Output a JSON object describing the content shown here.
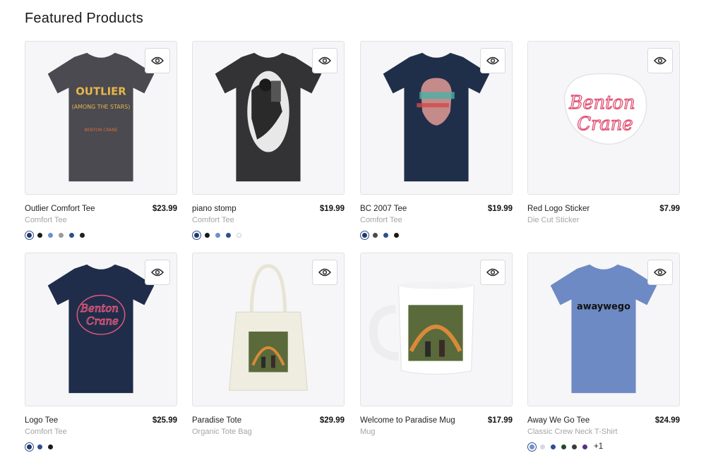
{
  "section": {
    "title": "Featured Products"
  },
  "products": [
    {
      "title": "Outlier Comfort Tee",
      "subtitle": "Comfort Tee",
      "price": "$23.99",
      "swatches": [
        "#1e3a6e",
        "#1a1a1a",
        "#6e8fcf",
        "#9a9a9a",
        "#2d4f8e",
        "#202020"
      ],
      "art": {
        "shirt_color": "#4a4a50",
        "lines": [
          "OUTLIER",
          "(AMONG THE STARS)",
          "BENTON CRANE"
        ]
      }
    },
    {
      "title": "piano stomp",
      "subtitle": "Comfort Tee",
      "price": "$19.99",
      "swatches": [
        "#1e3a6e",
        "#1a1a1a",
        "#6e8fcf",
        "#2d4f8e",
        "#ffffff"
      ],
      "art": {
        "shirt_color": "#333336"
      }
    },
    {
      "title": "BC 2007 Tee",
      "subtitle": "Comfort Tee",
      "price": "$19.99",
      "swatches": [
        "#1e3a6e",
        "#4a4a4a",
        "#2d4f8e",
        "#1a1a1a"
      ],
      "art": {
        "shirt_color": "#1f2f4a"
      }
    },
    {
      "title": "Red Logo Sticker",
      "subtitle": "Die Cut Sticker",
      "price": "$7.99",
      "swatches": [],
      "art": {
        "lines": [
          "Benton",
          "Crane"
        ]
      }
    },
    {
      "title": "Logo Tee",
      "subtitle": "Comfort Tee",
      "price": "$25.99",
      "swatches": [
        "#1e3a6e",
        "#2d4f8e",
        "#1a1a1a"
      ],
      "art": {
        "shirt_color": "#1f2d4a",
        "lines": [
          "Benton",
          "Crane"
        ]
      }
    },
    {
      "title": "Paradise Tote",
      "subtitle": "Organic Tote Bag",
      "price": "$29.99",
      "swatches": [],
      "art": {}
    },
    {
      "title": "Welcome to Paradise Mug",
      "subtitle": "Mug",
      "price": "$17.99",
      "swatches": [],
      "art": {}
    },
    {
      "title": "Away We Go Tee",
      "subtitle": "Classic Crew Neck T-Shirt",
      "price": "$24.99",
      "swatches": [
        "#6e8fcf",
        "#d8d8de",
        "#2d4f8e",
        "#1f4a2a",
        "#3a3a3a",
        "#5a2d8a"
      ],
      "more": "+1",
      "art": {
        "shirt_color": "#6e8ac4",
        "lines": [
          "awaywego"
        ]
      }
    }
  ],
  "icons": {
    "quickview": "eye-icon"
  }
}
